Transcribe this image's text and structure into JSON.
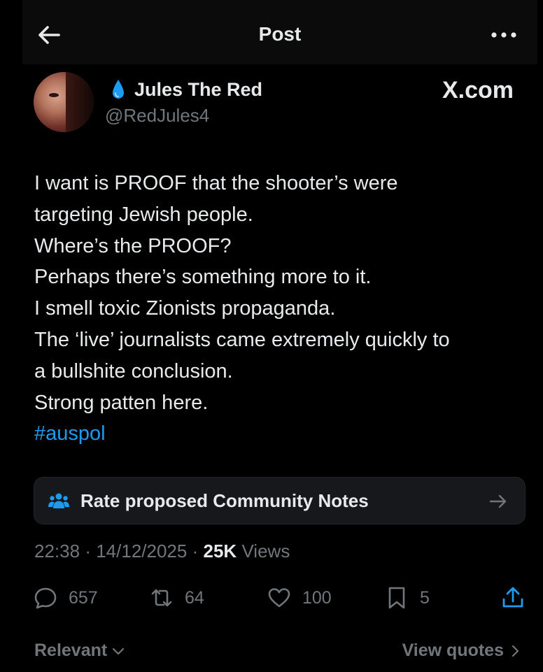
{
  "header": {
    "title": "Post",
    "back_icon": "arrow-left-icon",
    "more_icon": "more-horizontal-icon"
  },
  "author": {
    "display_name": "Jules The Red",
    "handle": "@RedJules4",
    "badge_icon": "water-drop-icon"
  },
  "watermark": "X.com",
  "post": {
    "lines": [
      "I want is PROOF that the shooter’s were",
      "targeting Jewish people.",
      "Where’s the PROOF?",
      "Perhaps there’s something more to it.",
      "I smell toxic Zionists propaganda.",
      "The ‘live’ journalists came extremely quickly to",
      "a bullshite conclusion.",
      "Strong patten here."
    ],
    "hashtag": "#auspol"
  },
  "community_notes": {
    "label": "Rate proposed Community Notes"
  },
  "meta": {
    "time": "22:38",
    "separator": "·",
    "date": "14/12/2025",
    "views_count": "25K",
    "views_label": "Views"
  },
  "actions": {
    "replies": "657",
    "reposts": "64",
    "likes": "100",
    "bookmarks": "5"
  },
  "footer": {
    "relevant_label": "Relevant",
    "view_quotes_label": "View quotes"
  },
  "colors": {
    "background": "#000000",
    "text_primary": "#e7e9ea",
    "text_secondary": "#71767b",
    "link": "#1d9bf0",
    "badge": "#1d9bf0"
  }
}
